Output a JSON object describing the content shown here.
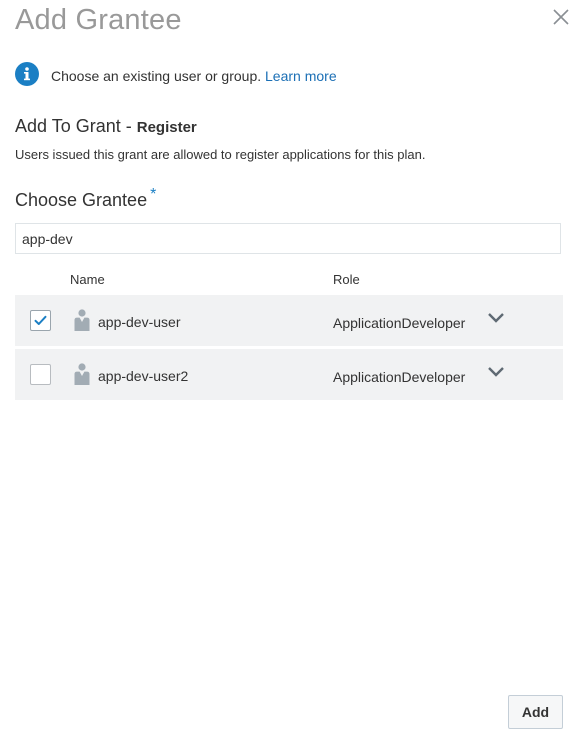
{
  "dialog": {
    "title": "Add Grantee",
    "close_icon": "close-icon"
  },
  "info": {
    "icon": "info-icon",
    "text": "Choose an existing user or group.",
    "link": "Learn more"
  },
  "grant": {
    "prefix": "Add To Grant -",
    "name": "Register",
    "description": "Users issued this grant are allowed to register applications for this plan."
  },
  "grantee": {
    "label": "Choose Grantee",
    "required_mark": "*",
    "search_value": "app-dev"
  },
  "table": {
    "columns": [
      "Name",
      "Role"
    ],
    "rows": [
      {
        "checked": true,
        "icon": "user-icon",
        "name": "app-dev-user",
        "role": "ApplicationDeveloper"
      },
      {
        "checked": false,
        "icon": "user-icon",
        "name": "app-dev-user2",
        "role": "ApplicationDeveloper"
      }
    ]
  },
  "footer": {
    "add_label": "Add"
  },
  "colors": {
    "accent": "#1b7fc4",
    "link": "#1b6fb5",
    "row_bg": "#f1f2f3"
  }
}
